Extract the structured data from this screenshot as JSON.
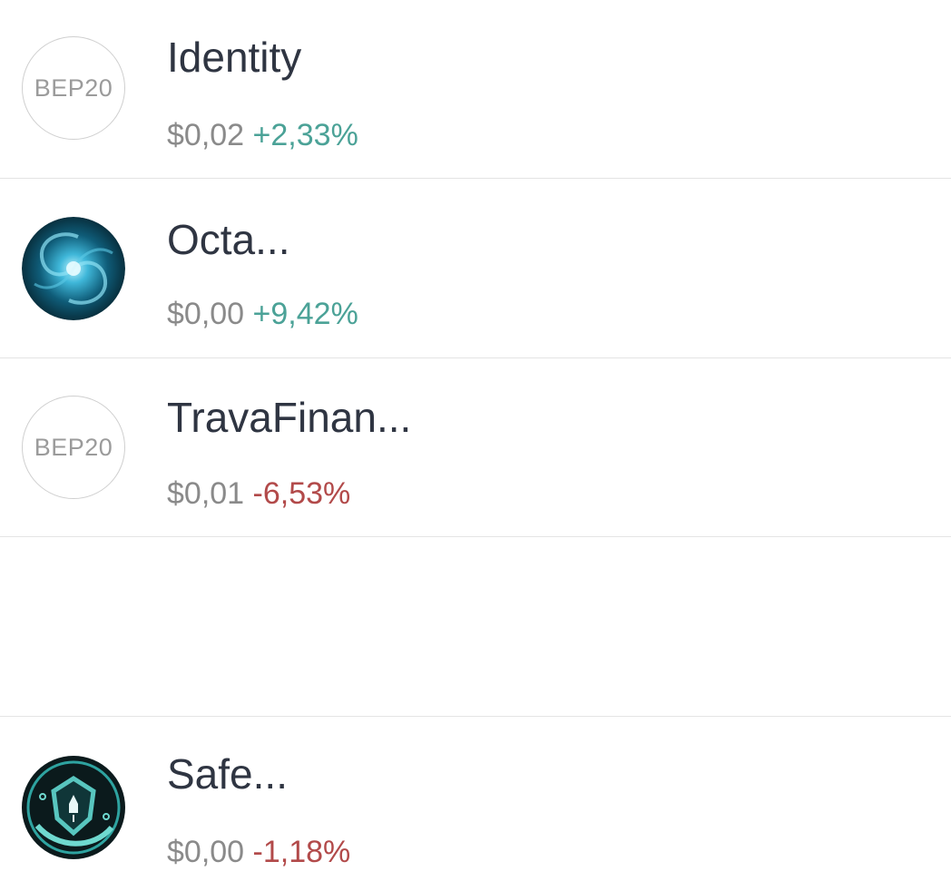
{
  "tokens": [
    {
      "name": "Identity",
      "logo_text": "BEP20",
      "logo_icon": "bep20-badge-icon",
      "price": "$0,02",
      "change": "+2,33%",
      "trend": "up"
    },
    {
      "name": "Octa...",
      "logo_icon": "galaxy-swirl-icon",
      "price": "$0,00",
      "change": "+9,42%",
      "trend": "up"
    },
    {
      "name": "TravaFinan...",
      "logo_text": "BEP20",
      "logo_icon": "bep20-badge-icon",
      "price": "$0,01",
      "change": "-6,53%",
      "trend": "down"
    },
    {
      "name": "Safe...",
      "logo_icon": "safe-shield-rocket-icon",
      "price": "$0,00",
      "change": "-1,18%",
      "trend": "down"
    }
  ],
  "colors": {
    "name": "#2f3542",
    "price": "#8a8a8a",
    "positive": "#4ba297",
    "negative": "#b24a4a",
    "divider": "#e4e4e4"
  }
}
